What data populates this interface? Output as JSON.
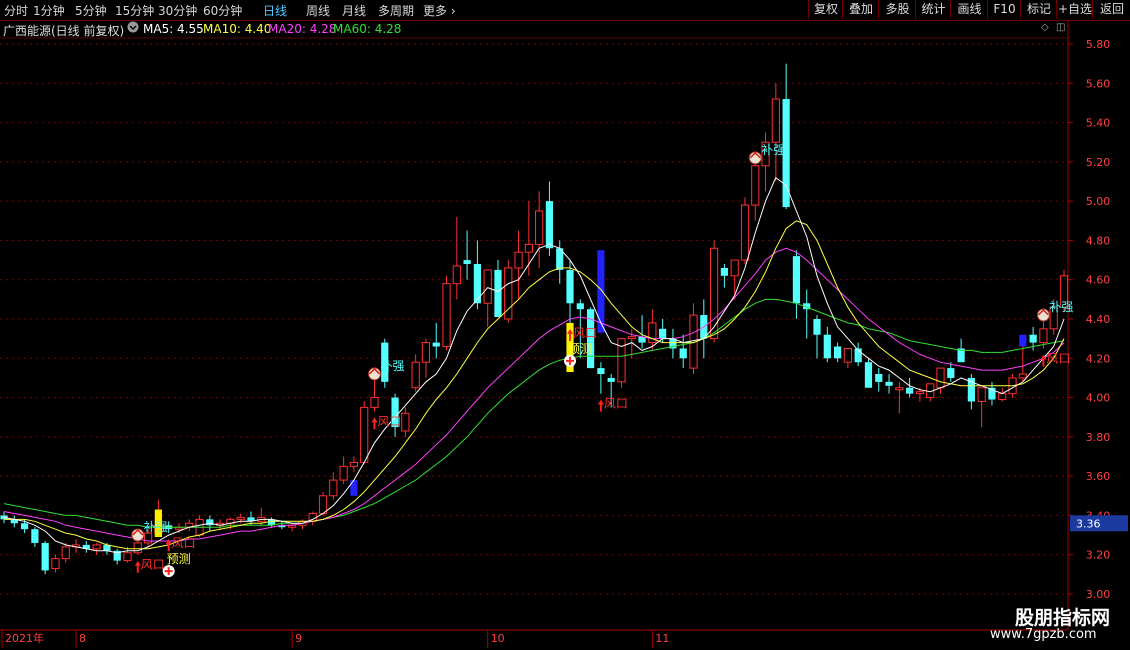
{
  "toolbar": {
    "periods": [
      "分时",
      "1分钟",
      "5分钟",
      "15分钟",
      "30分钟",
      "60分钟",
      "日线",
      "周线",
      "月线",
      "多周期",
      "更多"
    ],
    "active_period": "日线",
    "right_buttons": [
      "复权",
      "叠加",
      "多股",
      "统计",
      "画线",
      "F10",
      "标记",
      "+自选",
      "返回"
    ]
  },
  "legend": {
    "title": "广西能源(日线 前复权)",
    "ma5": "MA5: 4.55",
    "ma10": "MA10: 4.40",
    "ma20": "MA20: 4.28",
    "ma60": "MA60: 4.28"
  },
  "colors": {
    "up": "#ff3030",
    "down": "#54ffff",
    "ma5": "#ffffff",
    "ma10": "#ffff40",
    "ma20": "#ff40ff",
    "ma60": "#30e030",
    "grid": "#7a0000"
  },
  "watermark": {
    "line1": "股朋指标网",
    "line2": "www.7gpzb.com"
  },
  "chart_data": {
    "type": "candlestick",
    "ylim": [
      3.0,
      5.8
    ],
    "yticks": [
      "5.80",
      "5.60",
      "5.40",
      "5.20",
      "5.00",
      "4.80",
      "4.60",
      "4.40",
      "4.20",
      "4.00",
      "3.80",
      "3.60",
      "3.40",
      "3.20",
      "3.00"
    ],
    "current_price": "3.36",
    "x_labels": [
      {
        "text": "2021年",
        "index": 0
      },
      {
        "text": "8",
        "index": 7
      },
      {
        "text": "9",
        "index": 28
      },
      {
        "text": "10",
        "index": 47
      },
      {
        "text": "11",
        "index": 63
      }
    ],
    "candles": [
      [
        3.4,
        3.42,
        3.36,
        3.38
      ],
      [
        3.38,
        3.4,
        3.34,
        3.36
      ],
      [
        3.36,
        3.38,
        3.31,
        3.33
      ],
      [
        3.33,
        3.34,
        3.24,
        3.26
      ],
      [
        3.26,
        3.27,
        3.1,
        3.12
      ],
      [
        3.13,
        3.2,
        3.11,
        3.18
      ],
      [
        3.18,
        3.26,
        3.16,
        3.24
      ],
      [
        3.24,
        3.28,
        3.21,
        3.25
      ],
      [
        3.25,
        3.27,
        3.21,
        3.23
      ],
      [
        3.23,
        3.26,
        3.2,
        3.25
      ],
      [
        3.25,
        3.26,
        3.2,
        3.22
      ],
      [
        3.22,
        3.23,
        3.15,
        3.17
      ],
      [
        3.17,
        3.24,
        3.16,
        3.21
      ],
      [
        3.21,
        3.28,
        3.2,
        3.26
      ],
      [
        3.26,
        3.33,
        3.24,
        3.31
      ],
      [
        3.31,
        3.48,
        3.29,
        3.35
      ],
      [
        3.35,
        3.37,
        3.31,
        3.33
      ],
      [
        3.33,
        3.36,
        3.31,
        3.34
      ],
      [
        3.34,
        3.38,
        3.32,
        3.36
      ],
      [
        3.3,
        3.4,
        3.29,
        3.38
      ],
      [
        3.38,
        3.4,
        3.32,
        3.35
      ],
      [
        3.35,
        3.38,
        3.33,
        3.36
      ],
      [
        3.36,
        3.39,
        3.33,
        3.38
      ],
      [
        3.38,
        3.41,
        3.36,
        3.39
      ],
      [
        3.39,
        3.42,
        3.35,
        3.37
      ],
      [
        3.37,
        3.44,
        3.35,
        3.39
      ],
      [
        3.38,
        3.39,
        3.34,
        3.35
      ],
      [
        3.35,
        3.37,
        3.33,
        3.34
      ],
      [
        3.34,
        3.36,
        3.32,
        3.35
      ],
      [
        3.35,
        3.38,
        3.33,
        3.37
      ],
      [
        3.37,
        3.42,
        3.35,
        3.41
      ],
      [
        3.41,
        3.52,
        3.4,
        3.5
      ],
      [
        3.5,
        3.62,
        3.48,
        3.58
      ],
      [
        3.58,
        3.7,
        3.56,
        3.65
      ],
      [
        3.65,
        3.7,
        3.62,
        3.67
      ],
      [
        3.67,
        3.98,
        3.66,
        3.95
      ],
      [
        3.95,
        4.1,
        3.93,
        4.0
      ],
      [
        4.28,
        4.3,
        4.05,
        4.08
      ],
      [
        4.0,
        4.02,
        3.8,
        3.85
      ],
      [
        3.83,
        3.95,
        3.8,
        3.92
      ],
      [
        4.05,
        4.22,
        4.03,
        4.18
      ],
      [
        4.18,
        4.3,
        4.1,
        4.28
      ],
      [
        4.28,
        4.38,
        4.2,
        4.26
      ],
      [
        4.26,
        4.62,
        4.24,
        4.58
      ],
      [
        4.58,
        4.92,
        4.5,
        4.67
      ],
      [
        4.7,
        4.85,
        4.6,
        4.68
      ],
      [
        4.68,
        4.8,
        4.45,
        4.48
      ],
      [
        4.48,
        4.6,
        4.36,
        4.65
      ],
      [
        4.65,
        4.7,
        4.42,
        4.41
      ],
      [
        4.4,
        4.7,
        4.38,
        4.66
      ],
      [
        4.66,
        4.85,
        4.5,
        4.74
      ],
      [
        4.74,
        5.0,
        4.62,
        4.78
      ],
      [
        4.78,
        5.05,
        4.66,
        4.95
      ],
      [
        5.0,
        5.1,
        4.72,
        4.76
      ],
      [
        4.76,
        4.8,
        4.58,
        4.65
      ],
      [
        4.65,
        4.7,
        4.38,
        4.48
      ],
      [
        4.48,
        4.5,
        4.2,
        4.45
      ],
      [
        4.45,
        4.46,
        4.15,
        4.15
      ],
      [
        4.15,
        4.18,
        4.02,
        4.12
      ],
      [
        4.1,
        4.12,
        3.95,
        4.08
      ],
      [
        4.08,
        4.2,
        4.05,
        4.3
      ],
      [
        4.3,
        4.35,
        4.2,
        4.31
      ],
      [
        4.31,
        4.42,
        4.25,
        4.28
      ],
      [
        4.28,
        4.45,
        4.24,
        4.38
      ],
      [
        4.35,
        4.4,
        4.28,
        4.3
      ],
      [
        4.3,
        4.35,
        4.2,
        4.25
      ],
      [
        4.25,
        4.32,
        4.15,
        4.2
      ],
      [
        4.15,
        4.48,
        4.12,
        4.42
      ],
      [
        4.42,
        4.5,
        4.2,
        4.3
      ],
      [
        4.3,
        4.8,
        4.28,
        4.76
      ],
      [
        4.66,
        4.68,
        4.56,
        4.62
      ],
      [
        4.62,
        4.7,
        4.5,
        4.7
      ],
      [
        4.7,
        5.02,
        4.68,
        4.98
      ],
      [
        4.98,
        5.2,
        4.9,
        5.18
      ],
      [
        5.18,
        5.35,
        5.05,
        5.3
      ],
      [
        5.3,
        5.6,
        5.1,
        5.52
      ],
      [
        5.52,
        5.7,
        4.96,
        4.97
      ],
      [
        4.72,
        4.75,
        4.4,
        4.48
      ],
      [
        4.48,
        4.55,
        4.3,
        4.45
      ],
      [
        4.4,
        4.42,
        4.2,
        4.32
      ],
      [
        4.32,
        4.36,
        4.18,
        4.2
      ],
      [
        4.26,
        4.28,
        4.18,
        4.2
      ],
      [
        4.18,
        4.2,
        4.15,
        4.25
      ],
      [
        4.25,
        4.28,
        4.16,
        4.18
      ],
      [
        4.18,
        4.2,
        4.05,
        4.05
      ],
      [
        4.12,
        4.15,
        4.03,
        4.08
      ],
      [
        4.08,
        4.12,
        4.02,
        4.06
      ],
      [
        4.04,
        4.08,
        3.92,
        4.05
      ],
      [
        4.05,
        4.1,
        4.0,
        4.02
      ],
      [
        4.02,
        4.05,
        3.98,
        4.03
      ],
      [
        4.0,
        4.05,
        3.98,
        4.07
      ],
      [
        4.05,
        4.12,
        4.02,
        4.15
      ],
      [
        4.15,
        4.18,
        4.08,
        4.1
      ],
      [
        4.25,
        4.3,
        4.2,
        4.18
      ],
      [
        4.1,
        4.12,
        3.94,
        3.98
      ],
      [
        3.98,
        4.0,
        3.85,
        4.05
      ],
      [
        4.05,
        4.08,
        3.96,
        3.99
      ],
      [
        3.99,
        4.05,
        3.98,
        4.02
      ],
      [
        4.02,
        4.12,
        4.0,
        4.1
      ],
      [
        4.1,
        4.3,
        4.08,
        4.12
      ],
      [
        4.32,
        4.36,
        4.24,
        4.28
      ],
      [
        4.28,
        4.4,
        4.25,
        4.35
      ],
      [
        4.35,
        4.5,
        4.32,
        4.46
      ],
      [
        4.46,
        4.65,
        4.44,
        4.62
      ]
    ],
    "ma5": [
      3.39,
      3.38,
      3.37,
      3.35,
      3.32,
      3.27,
      3.25,
      3.24,
      3.23,
      3.22,
      3.22,
      3.21,
      3.22,
      3.22,
      3.24,
      3.27,
      3.3,
      3.32,
      3.34,
      3.35,
      3.36,
      3.35,
      3.36,
      3.37,
      3.37,
      3.38,
      3.38,
      3.37,
      3.36,
      3.36,
      3.38,
      3.41,
      3.45,
      3.51,
      3.58,
      3.67,
      3.77,
      3.84,
      3.9,
      3.96,
      4.02,
      4.08,
      4.12,
      4.2,
      4.34,
      4.44,
      4.5,
      4.56,
      4.54,
      4.58,
      4.6,
      4.68,
      4.76,
      4.78,
      4.76,
      4.7,
      4.62,
      4.5,
      4.38,
      4.28,
      4.26,
      4.28,
      4.24,
      4.26,
      4.3,
      4.3,
      4.28,
      4.29,
      4.3,
      4.36,
      4.44,
      4.52,
      4.66,
      4.84,
      5.0,
      5.12,
      5.08,
      4.95,
      4.82,
      4.62,
      4.48,
      4.36,
      4.3,
      4.24,
      4.2,
      4.16,
      4.14,
      4.1,
      4.06,
      4.04,
      4.03,
      4.05,
      4.07,
      4.1,
      4.08,
      4.06,
      4.04,
      4.02,
      4.05,
      4.08,
      4.14,
      4.2,
      4.26,
      4.4
    ],
    "ma10": [
      3.38,
      3.38,
      3.38,
      3.37,
      3.35,
      3.33,
      3.31,
      3.3,
      3.28,
      3.27,
      3.25,
      3.24,
      3.23,
      3.23,
      3.23,
      3.24,
      3.25,
      3.27,
      3.29,
      3.3,
      3.32,
      3.33,
      3.34,
      3.35,
      3.36,
      3.36,
      3.37,
      3.37,
      3.37,
      3.37,
      3.37,
      3.38,
      3.4,
      3.43,
      3.47,
      3.52,
      3.58,
      3.64,
      3.7,
      3.77,
      3.84,
      3.92,
      3.99,
      4.05,
      4.12,
      4.2,
      4.28,
      4.35,
      4.4,
      4.45,
      4.5,
      4.56,
      4.6,
      4.64,
      4.66,
      4.66,
      4.64,
      4.6,
      4.55,
      4.48,
      4.42,
      4.36,
      4.32,
      4.3,
      4.28,
      4.28,
      4.28,
      4.28,
      4.3,
      4.32,
      4.35,
      4.4,
      4.46,
      4.54,
      4.64,
      4.76,
      4.86,
      4.9,
      4.88,
      4.8,
      4.68,
      4.56,
      4.46,
      4.38,
      4.32,
      4.26,
      4.22,
      4.18,
      4.14,
      4.12,
      4.1,
      4.08,
      4.07,
      4.06,
      4.06,
      4.06,
      4.06,
      4.06,
      4.06,
      4.07,
      4.1,
      4.14,
      4.2,
      4.3
    ],
    "ma20": [
      3.42,
      3.41,
      3.4,
      3.39,
      3.38,
      3.37,
      3.35,
      3.34,
      3.33,
      3.32,
      3.31,
      3.3,
      3.29,
      3.28,
      3.27,
      3.27,
      3.27,
      3.27,
      3.28,
      3.28,
      3.29,
      3.3,
      3.31,
      3.32,
      3.32,
      3.33,
      3.34,
      3.35,
      3.35,
      3.36,
      3.37,
      3.38,
      3.39,
      3.41,
      3.43,
      3.46,
      3.5,
      3.54,
      3.58,
      3.62,
      3.66,
      3.71,
      3.76,
      3.81,
      3.87,
      3.93,
      3.99,
      4.05,
      4.1,
      4.15,
      4.2,
      4.25,
      4.3,
      4.34,
      4.37,
      4.4,
      4.41,
      4.4,
      4.38,
      4.36,
      4.34,
      4.32,
      4.31,
      4.3,
      4.3,
      4.3,
      4.31,
      4.33,
      4.36,
      4.4,
      4.45,
      4.51,
      4.57,
      4.63,
      4.7,
      4.74,
      4.76,
      4.74,
      4.7,
      4.65,
      4.6,
      4.55,
      4.5,
      4.45,
      4.4,
      4.36,
      4.32,
      4.28,
      4.25,
      4.22,
      4.2,
      4.18,
      4.17,
      4.16,
      4.15,
      4.14,
      4.14,
      4.14,
      4.15,
      4.16,
      4.18,
      4.2,
      4.23,
      4.28
    ],
    "ma60": [
      3.46,
      3.45,
      3.44,
      3.43,
      3.42,
      3.41,
      3.4,
      3.4,
      3.39,
      3.38,
      3.37,
      3.36,
      3.35,
      3.35,
      3.34,
      3.34,
      3.34,
      3.34,
      3.34,
      3.34,
      3.34,
      3.34,
      3.35,
      3.35,
      3.35,
      3.35,
      3.35,
      3.36,
      3.36,
      3.36,
      3.37,
      3.38,
      3.39,
      3.4,
      3.42,
      3.44,
      3.46,
      3.49,
      3.52,
      3.55,
      3.58,
      3.62,
      3.66,
      3.7,
      3.75,
      3.8,
      3.86,
      3.92,
      3.97,
      4.02,
      4.06,
      4.1,
      4.14,
      4.17,
      4.19,
      4.2,
      4.21,
      4.21,
      4.21,
      4.21,
      4.21,
      4.22,
      4.23,
      4.24,
      4.25,
      4.26,
      4.27,
      4.28,
      4.3,
      4.33,
      4.37,
      4.41,
      4.45,
      4.48,
      4.5,
      4.5,
      4.49,
      4.48,
      4.46,
      4.44,
      4.42,
      4.4,
      4.38,
      4.37,
      4.35,
      4.34,
      4.33,
      4.31,
      4.29,
      4.28,
      4.27,
      4.26,
      4.25,
      4.24,
      4.24,
      4.23,
      4.23,
      4.23,
      4.24,
      4.25,
      4.26,
      4.27,
      4.28,
      4.29
    ],
    "highlight_bars": [
      {
        "index": 15,
        "color": "#ffee00",
        "open": 3.29,
        "close": 3.43
      },
      {
        "index": 55,
        "color": "#ffee00",
        "open": 4.13,
        "close": 4.38
      },
      {
        "index": 58,
        "color": "#2222ff",
        "open": 4.33,
        "close": 4.75
      },
      {
        "index": 34,
        "color": "#2222ff",
        "open": 3.5,
        "close": 3.58
      },
      {
        "index": 99,
        "color": "#2222ff",
        "open": 4.26,
        "close": 4.32
      }
    ],
    "signals": [
      {
        "type": "bu",
        "text": "补强",
        "index": 13
      },
      {
        "type": "bu",
        "text": "补强",
        "index": 36
      },
      {
        "type": "bu",
        "text": "补强",
        "index": 73
      },
      {
        "type": "bu",
        "text": "补强",
        "index": 101
      },
      {
        "type": "feng",
        "text": "风口",
        "index": 13
      },
      {
        "type": "feng",
        "text": "风口",
        "index": 16
      },
      {
        "type": "feng",
        "text": "风口",
        "index": 36
      },
      {
        "type": "feng",
        "text": "风口",
        "index": 55
      },
      {
        "type": "feng",
        "text": "风口",
        "index": 58
      },
      {
        "type": "feng",
        "text": "风口",
        "index": 101
      },
      {
        "type": "yu",
        "text": "预测",
        "index": 16
      },
      {
        "type": "yu",
        "text": "预测",
        "index": 55
      }
    ]
  }
}
